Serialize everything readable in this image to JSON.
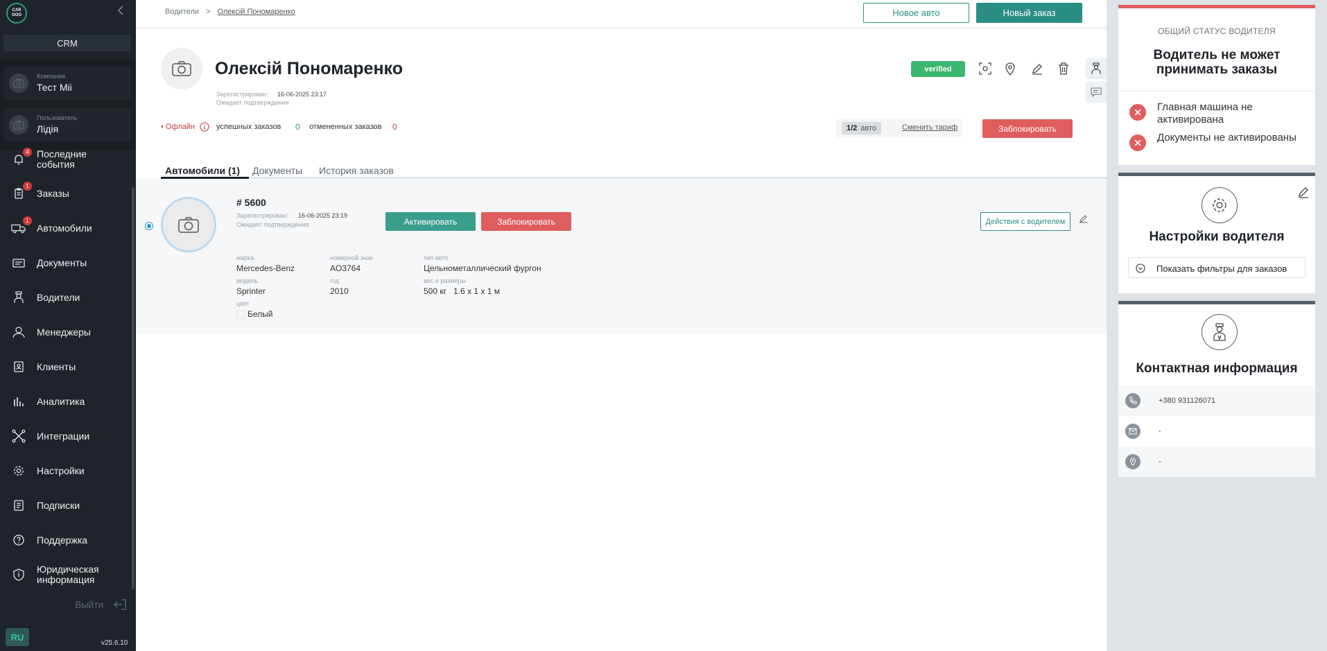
{
  "sidebar": {
    "logo_text_top": "CAR",
    "logo_text_bottom": "GOO",
    "crm_label": "CRM",
    "company_label": "Компания",
    "company_value": "Тест Mii",
    "user_label": "Пользователь",
    "user_value": "Лідія",
    "items": [
      {
        "label": "Последние события",
        "badge": "4",
        "icon": "bell-icon"
      },
      {
        "label": "Заказы",
        "badge": "1",
        "icon": "clipboard-icon"
      },
      {
        "label": "Автомобили",
        "badge": "1",
        "icon": "truck-icon"
      },
      {
        "label": "Документы",
        "badge": "",
        "icon": "documents-icon"
      },
      {
        "label": "Водители",
        "badge": "",
        "icon": "driver-icon"
      },
      {
        "label": "Менеджеры",
        "badge": "",
        "icon": "manager-icon"
      },
      {
        "label": "Клиенты",
        "badge": "",
        "icon": "clients-icon"
      },
      {
        "label": "Аналитика",
        "badge": "",
        "icon": "analytics-icon"
      },
      {
        "label": "Интеграции",
        "badge": "",
        "icon": "integrations-icon"
      },
      {
        "label": "Настройки",
        "badge": "",
        "icon": "gear-icon"
      },
      {
        "label": "Подписки",
        "badge": "",
        "icon": "subscriptions-icon"
      },
      {
        "label": "Поддержка",
        "badge": "",
        "icon": "help-icon"
      },
      {
        "label": "Юридическая информация",
        "badge": "",
        "icon": "shield-icon"
      }
    ],
    "logout_label": "Выйти",
    "language": "RU",
    "version": "v25.6.10"
  },
  "header": {
    "breadcrumb_root": "Водители",
    "breadcrumb_sep": ">",
    "breadcrumb_current": "Олексій Пономаренко",
    "new_car_button": "Новое авто",
    "new_order_button": "Новый заказ"
  },
  "driver": {
    "name": "Олексій Пономаренко",
    "registered_label": "Зарегистрирован:",
    "registered_value": "16-06-2025 23:17",
    "await_text": "Ожидает подтверждения",
    "verified_badge": "verified",
    "status_offline": "• Офлайн",
    "successful_label": "успешных заказов",
    "successful_count": "0",
    "cancelled_label": "отмененных заказов",
    "cancelled_count": "0",
    "tariff_count": "1/2",
    "tariff_unit": "авто",
    "change_tariff_link": "Сменить тариф",
    "block_button": "Заблокировать"
  },
  "tabs": [
    {
      "label": "Автомобили (1)",
      "active": true
    },
    {
      "label": "Документы",
      "active": false
    },
    {
      "label": "История заказов",
      "active": false
    }
  ],
  "car": {
    "number": "# 5600",
    "registered_label": "Зарегистрирован:",
    "registered_value": "16-06-2025 23:19",
    "await_text": "Ожидает подтверждения",
    "activate_button": "Активировать",
    "block_button": "Заблокировать",
    "actions_button": "Действия с водителем",
    "specs": {
      "brand_label": "марка",
      "brand_value": "Mercedes-Benz",
      "plate_label": "номерной знак",
      "plate_value": "AO3764",
      "type_label": "тип авто",
      "type_value": "Цельнометаллический фургон",
      "model_label": "модель",
      "model_value": "Sprinter",
      "year_label": "год",
      "year_value": "2010",
      "weight_label": "вес и размеры",
      "weight_value": "500 кг",
      "dims_value": "1.6 x 1 x 1 м",
      "color_label": "цвет",
      "color_value": "Белый"
    }
  },
  "status_card": {
    "subtitle": "ОБЩИЙ СТАТУС ВОДИТЕЛЯ",
    "title": "Водитель не может принимать заказы",
    "errors": [
      "Главная машина не активирована",
      "Документы не активированы"
    ]
  },
  "settings_card": {
    "title": "Настройки водителя",
    "filters_button": "Показать фильтры для заказов"
  },
  "contact_card": {
    "title": "Контактная информация",
    "phone": "+380 931126071",
    "email": "-",
    "address": "-"
  },
  "colors": {
    "accent": "#2b8e83",
    "danger": "#e05d5d",
    "success": "#3bb76f",
    "sidebar_bg": "#1e242a"
  }
}
